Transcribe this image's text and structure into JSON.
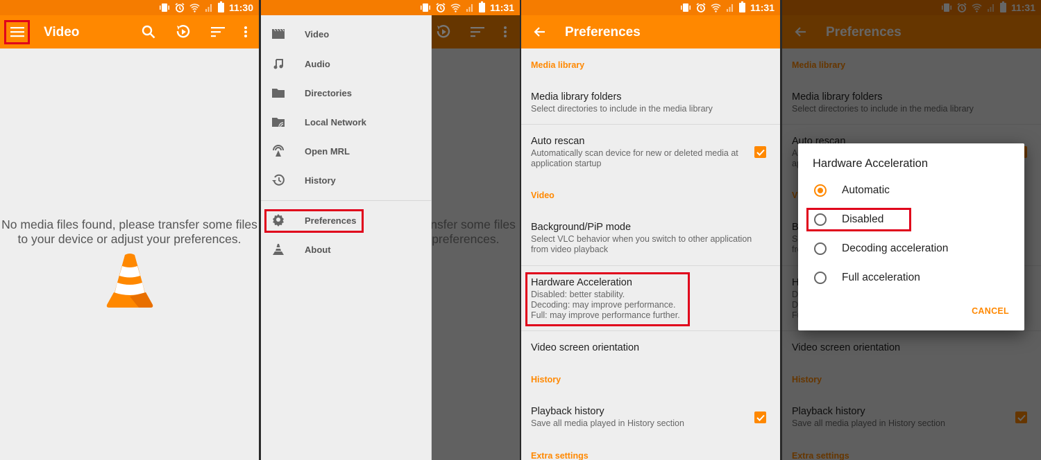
{
  "status_bar": {
    "p1_time": "11:30",
    "p2_time": "11:31",
    "p3_time": "11:31",
    "p4_time": "11:31",
    "icons": [
      "vibrate-icon",
      "alarm-icon",
      "wifi-icon",
      "signal-icon",
      "battery-icon"
    ]
  },
  "colors": {
    "brand_orange": "#ff8800",
    "status_orange": "#f57c00",
    "highlight_red": "#e0001b"
  },
  "video_screen": {
    "title": "Video",
    "toolbar_icons": [
      "search-icon",
      "resume-playback-icon",
      "sort-icon",
      "overflow-menu-icon"
    ],
    "empty_message": "No media files found, please transfer some files to your device or adjust your preferences."
  },
  "drawer": {
    "items": [
      {
        "label": "Video",
        "icon": "video-icon"
      },
      {
        "label": "Audio",
        "icon": "music-note-icon"
      },
      {
        "label": "Directories",
        "icon": "folder-icon"
      },
      {
        "label": "Local Network",
        "icon": "network-folder-icon"
      },
      {
        "label": "Open MRL",
        "icon": "antenna-icon"
      },
      {
        "label": "History",
        "icon": "history-icon"
      },
      {
        "label": "Preferences",
        "icon": "gear-icon"
      },
      {
        "label": "About",
        "icon": "vlc-cone-icon"
      }
    ],
    "background_text": "No media files found, please transfer some files to your device or adjust your preferences."
  },
  "preferences": {
    "title": "Preferences",
    "categories": {
      "media_library": "Media library",
      "video": "Video",
      "history": "History",
      "extra": "Extra settings"
    },
    "items": {
      "media_library_folders": {
        "title": "Media library folders",
        "summary": "Select directories to include in the media library"
      },
      "auto_rescan": {
        "title": "Auto rescan",
        "summary": "Automatically scan device for new or deleted media at application startup",
        "checked": true
      },
      "background_pip": {
        "title": "Background/PiP mode",
        "summary": "Select VLC behavior when you switch to other application from video playback"
      },
      "hw_accel": {
        "title": "Hardware Acceleration",
        "summary_lines": [
          "Disabled: better stability.",
          "Decoding: may improve performance.",
          "Full: may improve performance further."
        ]
      },
      "orientation": {
        "title": "Video screen orientation"
      },
      "playback_history": {
        "title": "Playback history",
        "summary": "Save all media played in History section",
        "checked": true
      }
    }
  },
  "hw_dialog": {
    "title": "Hardware Acceleration",
    "options": [
      {
        "label": "Automatic",
        "selected": true
      },
      {
        "label": "Disabled",
        "selected": false
      },
      {
        "label": "Decoding acceleration",
        "selected": false
      },
      {
        "label": "Full acceleration",
        "selected": false
      }
    ],
    "cancel_label": "CANCEL"
  }
}
